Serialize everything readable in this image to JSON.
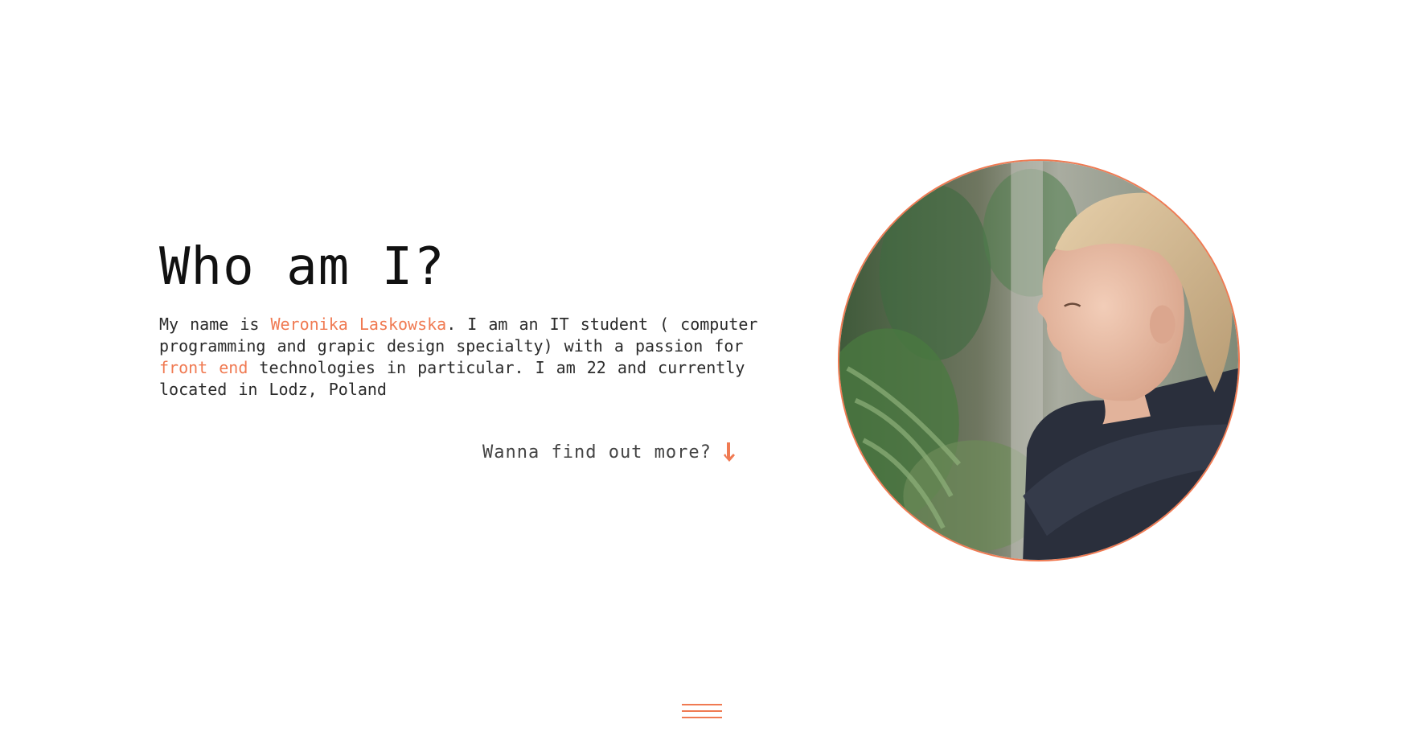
{
  "hero": {
    "title": "Who am I?",
    "bio": {
      "part1": "My name is ",
      "name": "Weronika Laskowska",
      "part2": ". I am an IT student ( computer programming and grapic design specialty) with a passion for ",
      "highlight": "front end",
      "part3": " technologies in particular. I am 22 and currently located in Lodz, Poland"
    }
  },
  "more_link": {
    "label": "Wanna find out more?",
    "icon": "arrow-down-icon"
  },
  "portrait": {
    "icon": "profile-photo"
  },
  "menu": {
    "icon": "hamburger-menu-icon"
  },
  "colors": {
    "accent": "#f07a52",
    "text": "#222222",
    "background": "#ffffff"
  }
}
